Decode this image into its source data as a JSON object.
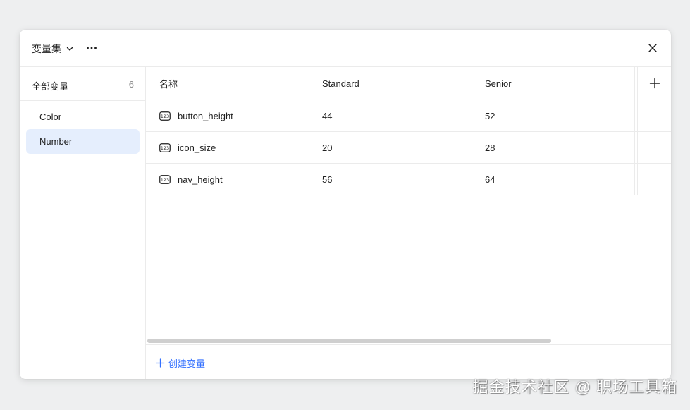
{
  "header": {
    "title": "变量集",
    "chevron_icon": "chevron-down-icon",
    "more_icon": "more-horizontal-icon",
    "close_icon": "close-icon"
  },
  "sidebar": {
    "all_label": "全部变量",
    "all_count": "6",
    "items": [
      {
        "label": "Color",
        "active": false
      },
      {
        "label": "Number",
        "active": true
      }
    ]
  },
  "table": {
    "columns": [
      "名称",
      "Standard",
      "Senior"
    ],
    "add_column_icon": "plus-icon",
    "row_icon": "number-type-icon",
    "rows": [
      {
        "name": "button_height",
        "standard": "44",
        "senior": "52"
      },
      {
        "name": "icon_size",
        "standard": "20",
        "senior": "28"
      },
      {
        "name": "nav_height",
        "standard": "56",
        "senior": "64"
      }
    ],
    "scroll_position": 0
  },
  "footer": {
    "create_label": "创建变量",
    "create_icon": "plus-icon"
  },
  "watermark": "掘金技术社区 @ 职场工具箱",
  "colors": {
    "accent": "#3370ff",
    "active_item_bg": "#e5eefd",
    "background": "#eeeff0"
  }
}
